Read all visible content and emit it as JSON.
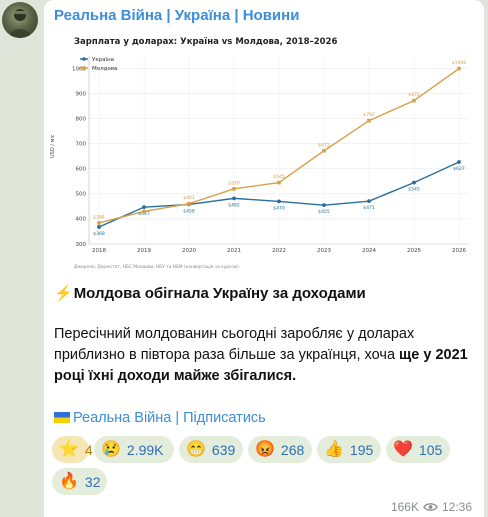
{
  "channel": {
    "name": "Реальна Війна | Україна | Новини"
  },
  "chart_data": {
    "type": "line",
    "title": "Зарплата у доларах: Україна vs Молдова, 2018–2026",
    "ylabel": "USD / міс",
    "xlabel": "",
    "categories": [
      "2018",
      "2019",
      "2020",
      "2021",
      "2022",
      "2023",
      "2024",
      "2025",
      "2026"
    ],
    "ylim": [
      300,
      1050
    ],
    "yticks": [
      "300",
      "400",
      "500",
      "600",
      "700",
      "800",
      "900",
      "1000"
    ],
    "source": "Джерело: Держстат, НБС Молдови, НБУ та НБМ (конвертація за курсом)",
    "legend_position": "top-left",
    "series": [
      {
        "name": "Україна",
        "color": "#2a6f9b",
        "values": [
          368,
          447,
          458,
          482,
          470,
          455,
          471,
          545,
          627
        ],
        "labels": [
          "$368",
          "$447",
          "$458",
          "$482",
          "$470",
          "$455",
          "$471",
          "$545",
          "$627"
        ]
      },
      {
        "name": "Молдова",
        "color": "#d9a04a",
        "values": [
          384,
          430,
          461,
          520,
          545,
          672,
          792,
          872,
          1000
        ],
        "labels": [
          "$384",
          "",
          "$461",
          "$520",
          "$545",
          "$672",
          "$792",
          "$872",
          "$1000"
        ]
      }
    ]
  },
  "post": {
    "headline": "Молдова обігнала Україну за доходами",
    "body_plain": "Пересічний молдованин сьогодні заробляє у доларах приблизно в півтора раза більше за українця, хоча ",
    "body_bold": "ще у 2021 році їхні доходи майже збігалися."
  },
  "links": {
    "channel_link": "Реальна Війна",
    "separator": "|",
    "subscribe": "Підписатись"
  },
  "reactions": [
    {
      "icon": "star-icon",
      "glyph": "⭐",
      "count": "4"
    },
    {
      "icon": "crying-face-icon",
      "glyph": "😢",
      "count": "2.99K"
    },
    {
      "icon": "grinning-face-icon",
      "glyph": "😁",
      "count": "639"
    },
    {
      "icon": "angry-face-icon",
      "glyph": "😡",
      "count": "268"
    },
    {
      "icon": "thumbs-up-icon",
      "glyph": "👍",
      "count": "195"
    },
    {
      "icon": "heart-icon",
      "glyph": "❤️",
      "count": "105"
    },
    {
      "icon": "fire-icon",
      "glyph": "🔥",
      "count": "32"
    }
  ],
  "meta": {
    "views": "166K",
    "time": "12:36"
  }
}
